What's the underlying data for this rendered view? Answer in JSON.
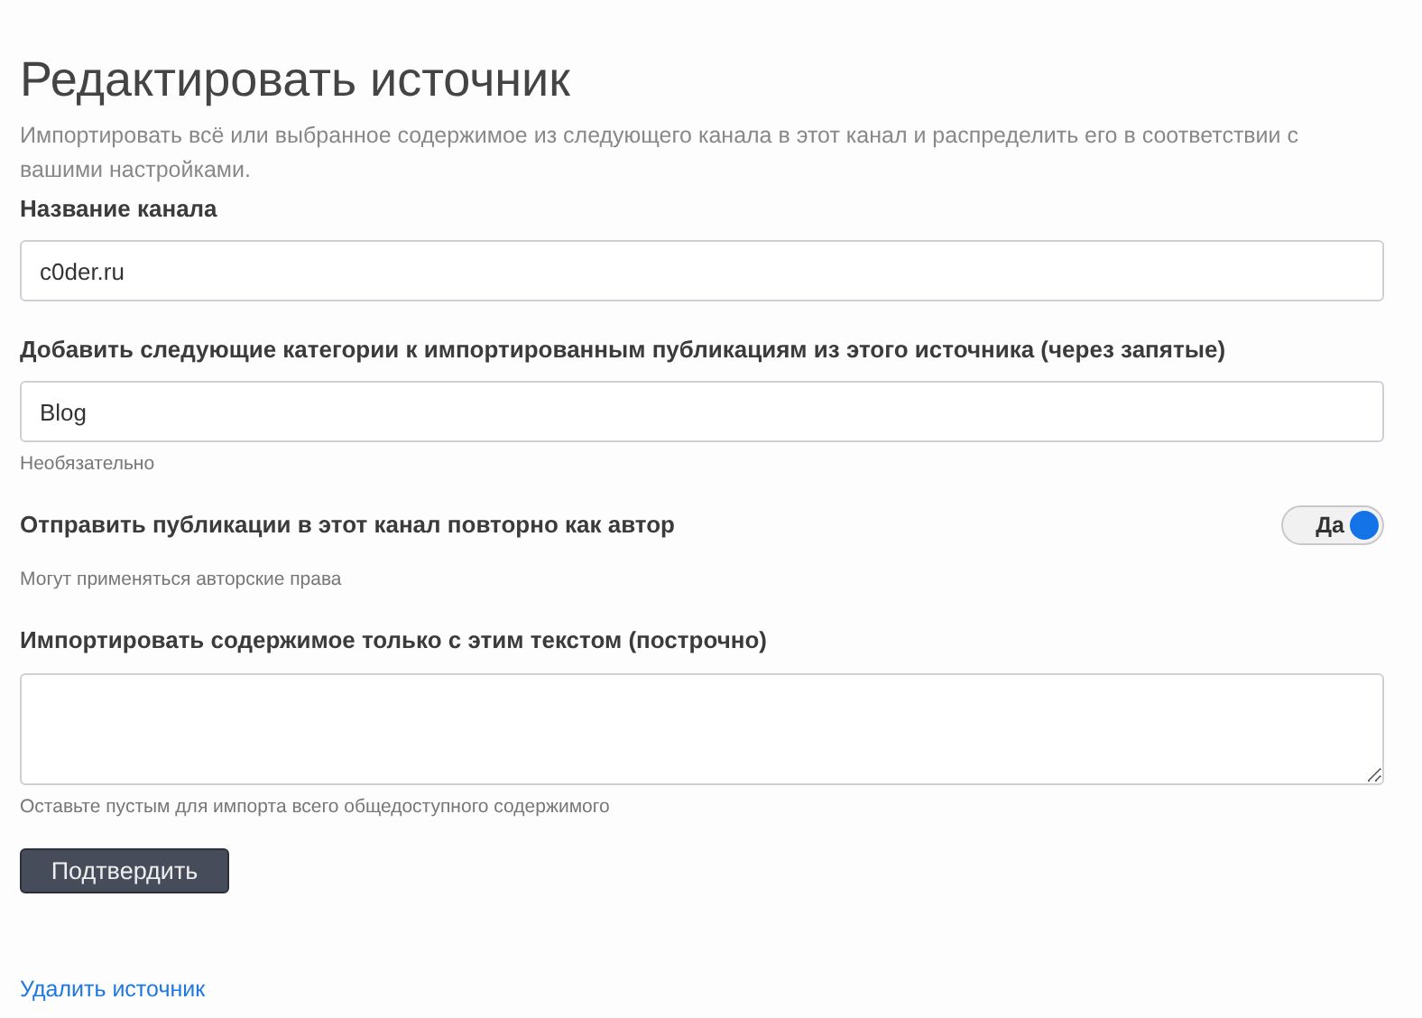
{
  "title": "Редактировать источник",
  "description": "Импортировать всё или выбранное содержимое из следующего канала в этот канал и распределить его в соответствии с вашими настройками.",
  "fields": [
    {
      "kind": "input",
      "label": "Название канала",
      "value": "c0der.ru"
    },
    {
      "kind": "input",
      "label": "Добавить следующие категории к импортированным публикациям из этого источника (через запятые)",
      "value": "Blog",
      "hint": "Необязательно"
    },
    {
      "kind": "toggle",
      "label": "Отправить публикации в этот канал повторно как автор",
      "toggle_label": "Да",
      "on": true,
      "hint": "Могут применяться авторские права"
    },
    {
      "kind": "textarea",
      "label": "Импортировать содержимое только с этим текстом (построчно)",
      "hint": "Оставьте пустым для импорта всего общедоступного содержимого"
    }
  ],
  "submit": "Подтвердить",
  "delete_link": "Удалить источник"
}
